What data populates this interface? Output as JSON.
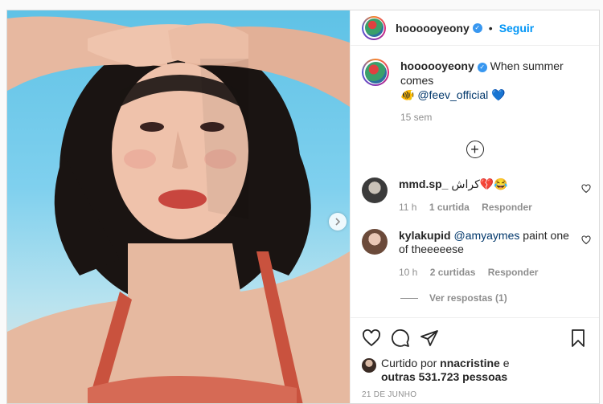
{
  "post": {
    "author": "hoooooyeony",
    "follow_label": "Seguir",
    "separator": "•",
    "caption": {
      "author": "hoooooyeony",
      "text": "When summer comes",
      "emoji": "🐠",
      "mention": "@feev_official",
      "heart": "💙",
      "age": "15 sem"
    },
    "load_more_icon": "plus-circle-icon",
    "comments": [
      {
        "user": "mmd.sp_",
        "text": "كراش💔😂",
        "time": "11 h",
        "likes": "1 curtida",
        "reply": "Responder"
      },
      {
        "user": "kylakupid",
        "mention": "@amyaymes",
        "text": "paint one of theeeeese",
        "time": "10 h",
        "likes": "2 curtidas",
        "reply": "Responder"
      }
    ],
    "view_replies": "Ver respostas (1)",
    "likes": {
      "prefix": "Curtido por",
      "user": "nnacristine",
      "conj": "e",
      "others": "outras 531.723 pessoas"
    },
    "date": "21 DE JUNHO"
  },
  "colors": {
    "link": "#0095f6",
    "mention": "#00376b",
    "muted": "#8e8e8e",
    "verified": "#3897f0"
  }
}
